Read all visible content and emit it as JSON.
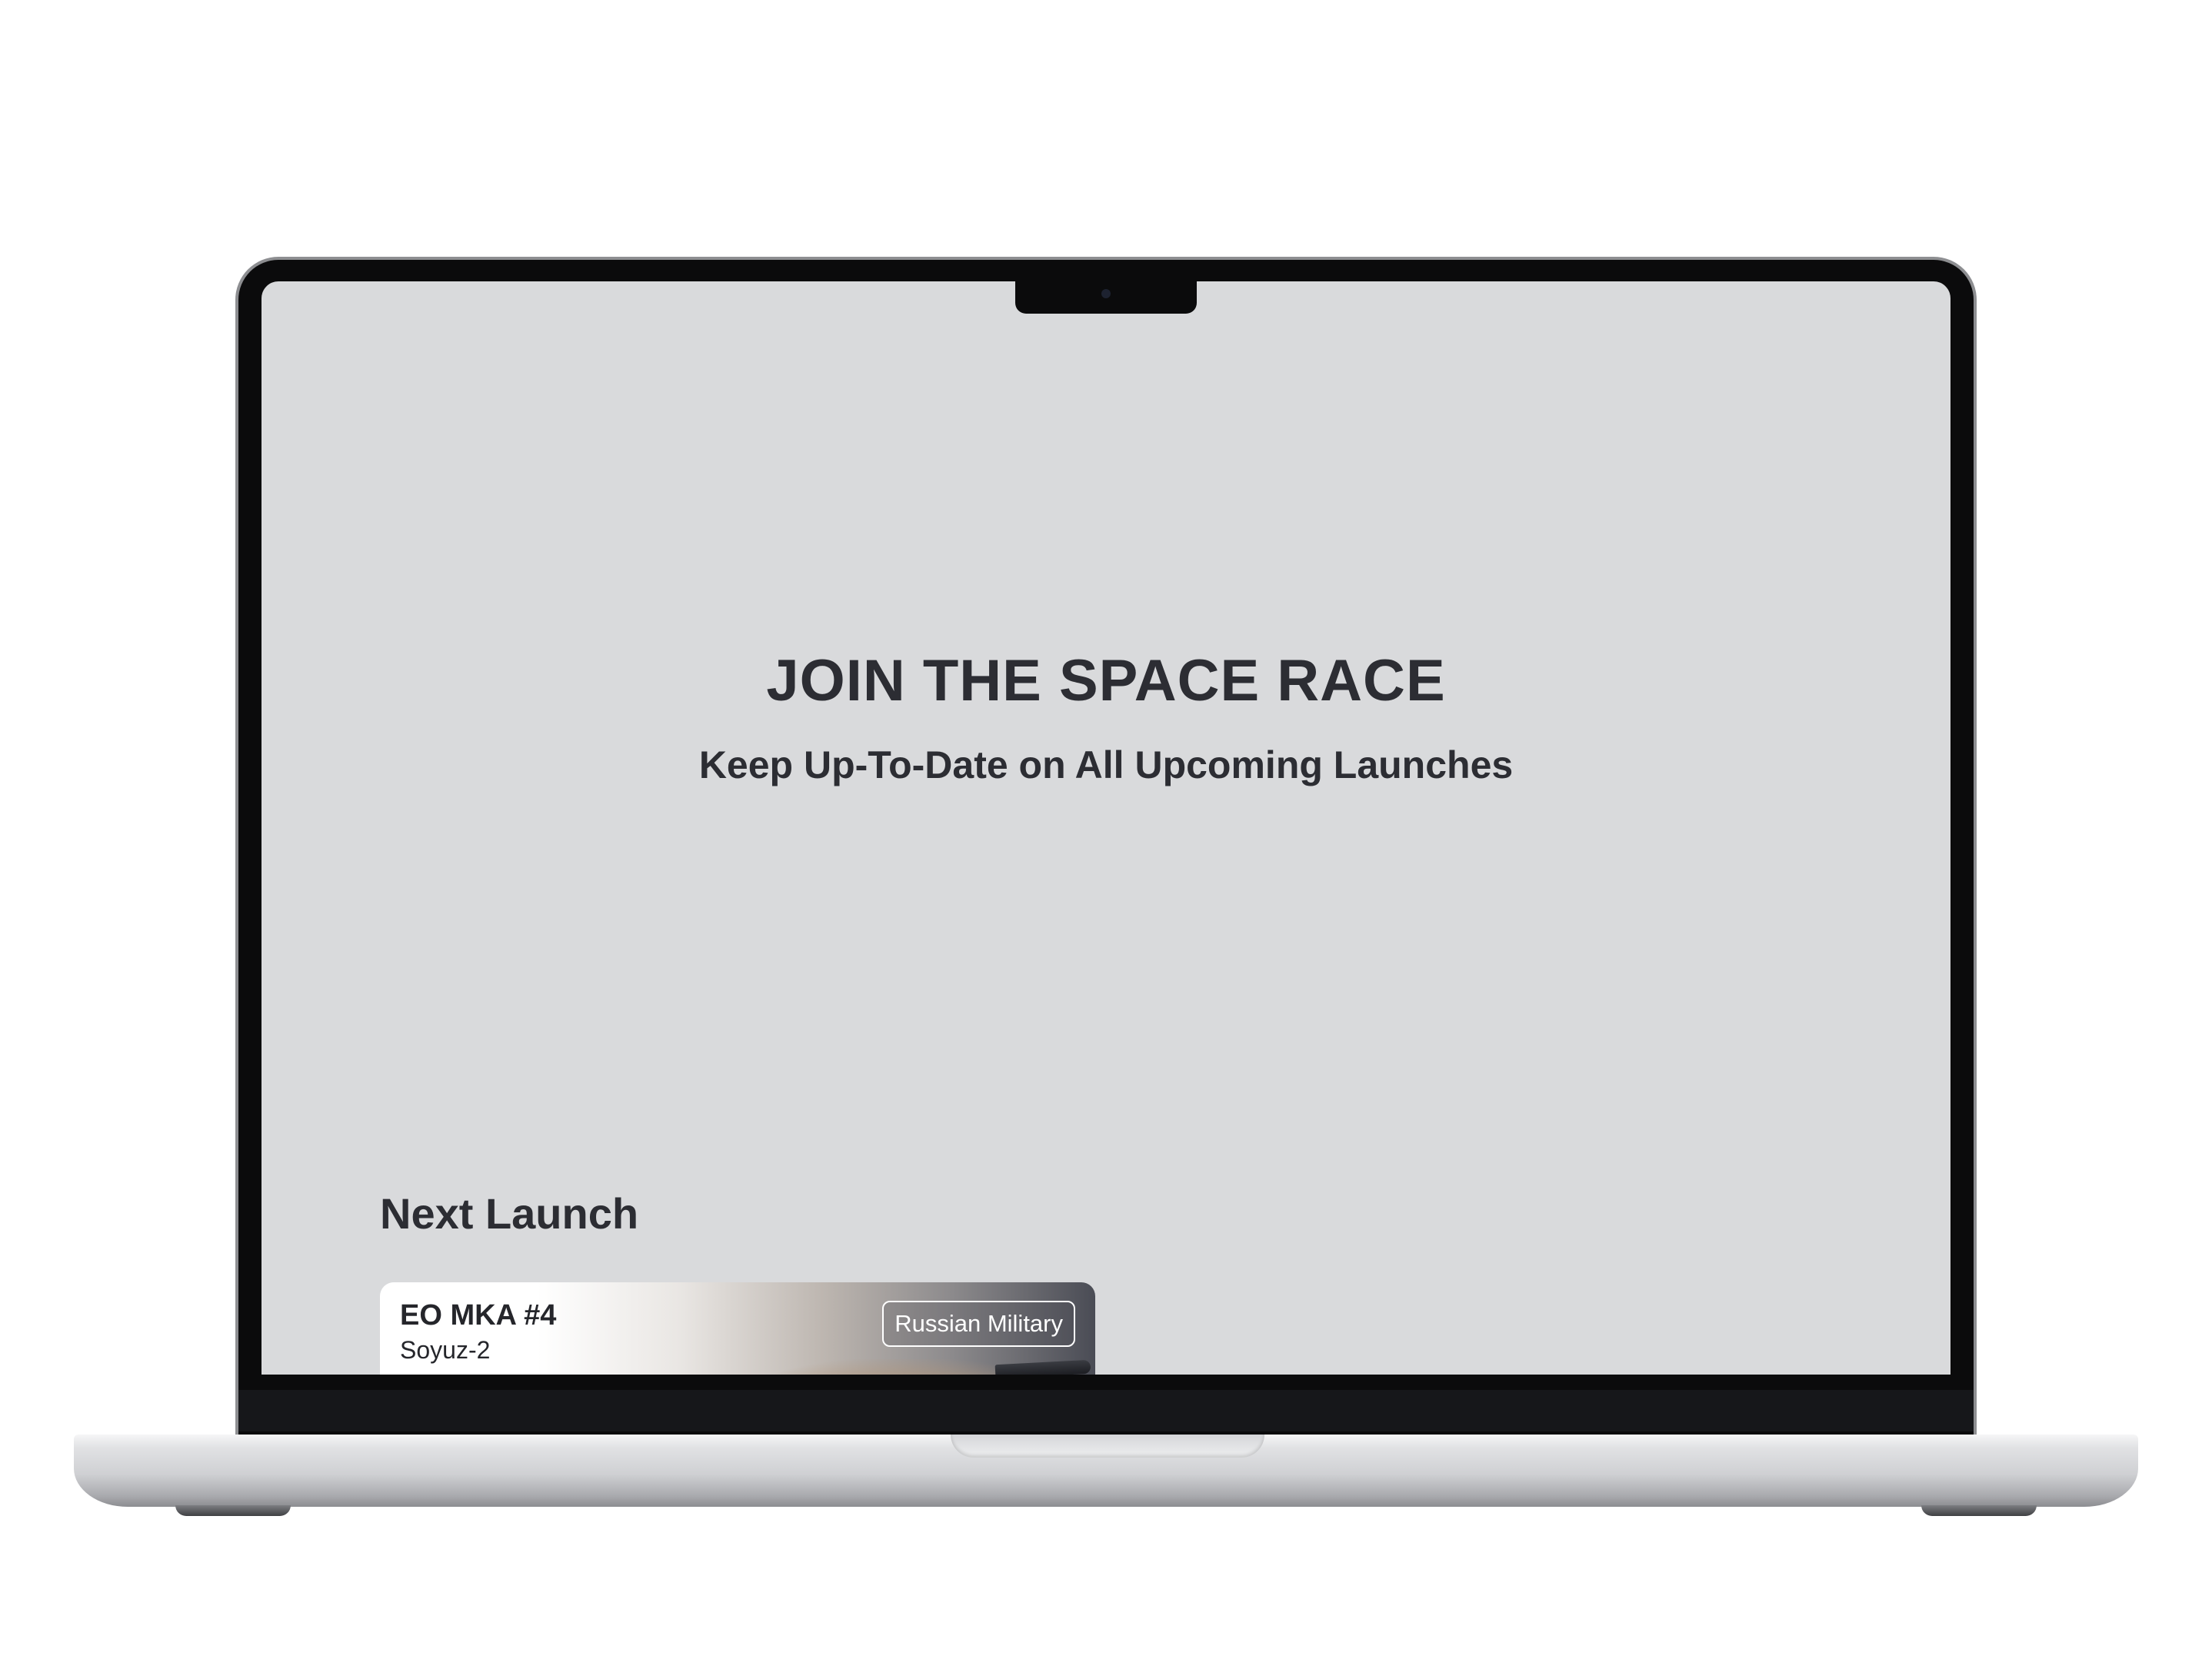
{
  "hero": {
    "title": "JOIN THE SPACE RACE",
    "subtitle": "Keep Up-To-Date on All Upcoming Launches"
  },
  "next_launch": {
    "section_title": "Next Launch",
    "card": {
      "name": "EO MKA #4",
      "rocket": "Soyuz-2",
      "agency_badge": "Russian Military"
    }
  },
  "theme": {
    "screen_background": "#d9dadc",
    "text_color": "#2c2d33",
    "device_frame": "#0b0b0c",
    "device_body": "#cfd0d3"
  }
}
